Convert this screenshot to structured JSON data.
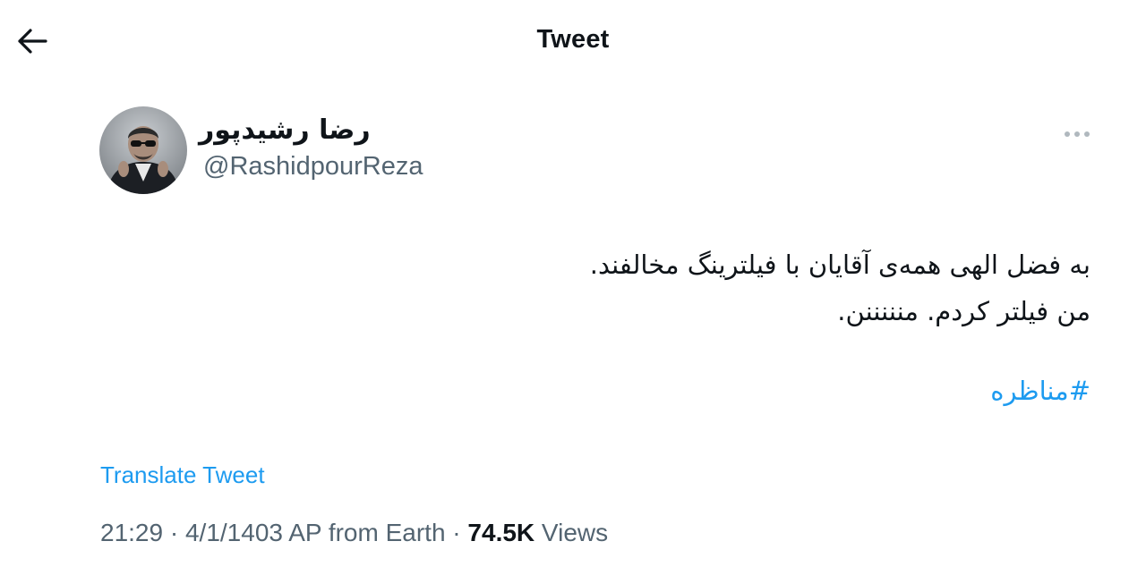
{
  "header": {
    "title": "Tweet",
    "back_icon": "arrow-left-icon"
  },
  "author": {
    "display_name": "رضا رشیدپور",
    "handle": "@RashidpourReza",
    "avatar_icon": "user-avatar-photo"
  },
  "more_icon": "more-horizontal-icon",
  "tweet": {
    "line1": "به فضل الهی همه‌ی آقایان با فیلترینگ مخالفند.",
    "line2": "من فیلتر کردم. منننننن.",
    "hashtag": "#مناظره"
  },
  "translate_label": "Translate Tweet",
  "meta": {
    "time": "21:29",
    "separator": " · ",
    "date": "4/1/1403 AP from Earth",
    "views_count": "74.5K",
    "views_label": "Views"
  },
  "colors": {
    "link": "#1d9bf0",
    "secondary_text": "#536471",
    "primary_text": "#0f1419"
  }
}
